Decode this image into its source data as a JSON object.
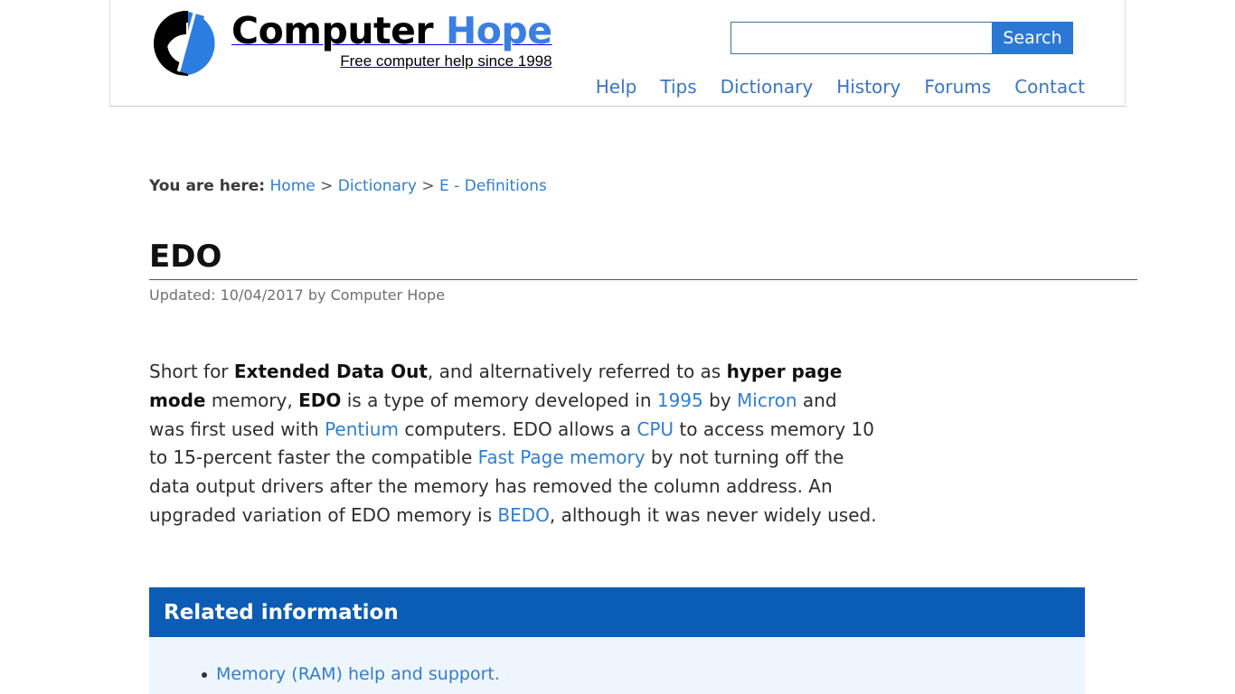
{
  "header": {
    "logo": {
      "icon_name": "computer-hope-logo",
      "title_part1": "Computer",
      "title_part2": "Hope",
      "tagline": "Free computer help since 1998",
      "colors": {
        "dark": "#000000",
        "blue": "#3a7fe0"
      }
    },
    "search": {
      "value": "",
      "placeholder": "",
      "button_label": "Search",
      "button_color": "#2b78d4",
      "border_color": "#3f6f9e"
    },
    "nav": [
      {
        "label": "Help"
      },
      {
        "label": "Tips"
      },
      {
        "label": "Dictionary"
      },
      {
        "label": "History"
      },
      {
        "label": "Forums"
      },
      {
        "label": "Contact"
      }
    ],
    "nav_link_color": "#3a76c4"
  },
  "breadcrumb": {
    "label": "You are here:",
    "items": [
      {
        "label": "Home",
        "link": true
      },
      {
        "label": "Dictionary",
        "link": true
      },
      {
        "label": "E - Definitions",
        "link": true
      }
    ],
    "separator": ">"
  },
  "page": {
    "title": "EDO",
    "updated": "Updated: 10/04/2017 by Computer Hope",
    "definition": {
      "parts": [
        {
          "text": "Short for ",
          "style": "normal"
        },
        {
          "text": "Extended Data Out",
          "style": "bold"
        },
        {
          "text": ", and alternatively referred to as ",
          "style": "normal"
        },
        {
          "text": "hyper page mode",
          "style": "bold"
        },
        {
          "text": " memory, ",
          "style": "normal"
        },
        {
          "text": "EDO",
          "style": "bold"
        },
        {
          "text": " is a type of memory developed in ",
          "style": "normal"
        },
        {
          "text": "1995",
          "style": "link"
        },
        {
          "text": " by ",
          "style": "normal"
        },
        {
          "text": "Micron",
          "style": "link"
        },
        {
          "text": " and was first used with ",
          "style": "normal"
        },
        {
          "text": "Pentium",
          "style": "link"
        },
        {
          "text": " computers. EDO allows a ",
          "style": "normal"
        },
        {
          "text": "CPU",
          "style": "link"
        },
        {
          "text": " to access memory 10 to 15-percent faster the compatible ",
          "style": "normal"
        },
        {
          "text": "Fast Page memory",
          "style": "link"
        },
        {
          "text": " by not turning off the data output drivers after the memory has removed the column address. An upgraded variation of EDO memory is ",
          "style": "normal"
        },
        {
          "text": "BEDO",
          "style": "link"
        },
        {
          "text": ", although it was never widely used.",
          "style": "normal"
        }
      ]
    }
  },
  "related": {
    "title": "Related information",
    "header_color": "#0b5cb5",
    "body_color": "#eff5fd",
    "items": [
      {
        "label": "Memory (RAM) help and support."
      }
    ]
  },
  "link_color": "#2f7fd1"
}
